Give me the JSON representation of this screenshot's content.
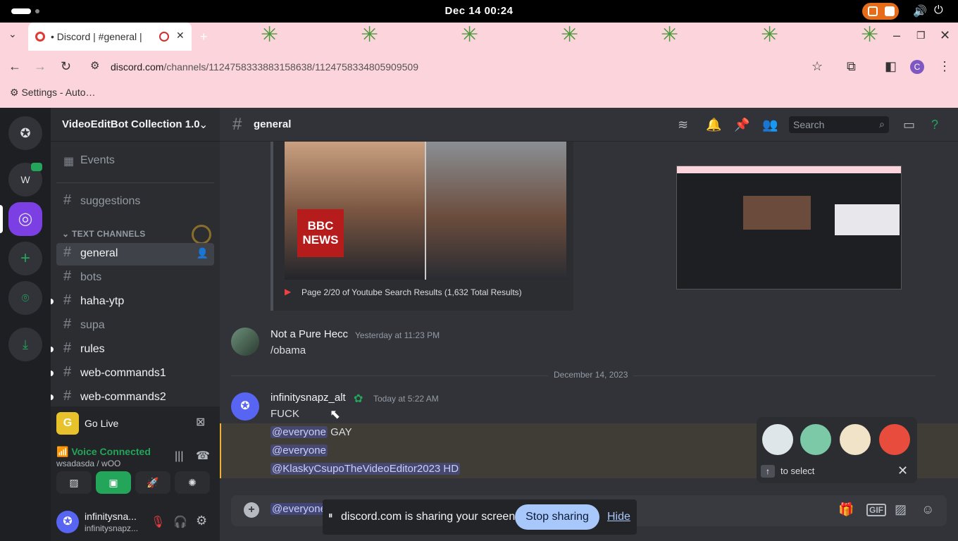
{
  "os": {
    "clock": "Dec 14  00:24"
  },
  "browser": {
    "tab_title": "• Discord | #general |",
    "new_tab": "+",
    "url_host": "discord.com",
    "url_path": "/channels/1124758333883158638/1124758334805909509",
    "bookmark": "Settings - Auto…",
    "profile_initial": "C"
  },
  "guilds": {
    "dm_initial": "W"
  },
  "sidebar": {
    "server_name": "VideoEditBot Collection 1.0",
    "events_label": "Events",
    "category": "TEXT CHANNELS",
    "channels": [
      {
        "label": "suggestions"
      },
      {
        "label": "general"
      },
      {
        "label": "bots"
      },
      {
        "label": "haha-ytp"
      },
      {
        "label": "supa"
      },
      {
        "label": "rules"
      },
      {
        "label": "web-commands1"
      },
      {
        "label": "web-commands2"
      }
    ],
    "go_live": "Go Live",
    "go_live_initial": "G",
    "voice_status": "Voice Connected",
    "voice_channel": "wsadasda / wOO",
    "user_display": "infinitysna...",
    "user_tag": "infinitysnapz..."
  },
  "header": {
    "channel": "general",
    "search_placeholder": "Search"
  },
  "embed": {
    "caption": "Page 2/20 of Youtube Search Results (1,632 Total Results)",
    "bbc_line1": "BBC",
    "bbc_line2": "NEWS"
  },
  "messages": [
    {
      "author": "Not a Pure Hecc",
      "timestamp": "Yesterday at 11:23 PM",
      "lines": [
        "/obama"
      ]
    },
    {
      "author": "infinitysnapz_alt",
      "timestamp": "Today at 5:22 AM",
      "lines": [
        "FUCK"
      ],
      "mention1": "@everyone",
      "mention1_tail": "GAY",
      "mention2": "@everyone",
      "mention3": "@KlaskyCsupoTheVideoEditor2023 HD"
    }
  ],
  "date_divider": "December 14, 2023",
  "composer": {
    "draft": "@everyone"
  },
  "share_bar": {
    "text": "discord.com is sharing your screen.",
    "stop": "Stop sharing",
    "hide": "Hide",
    "pause_icon": "⏸"
  },
  "sticker_picker": {
    "hint": "to select"
  }
}
